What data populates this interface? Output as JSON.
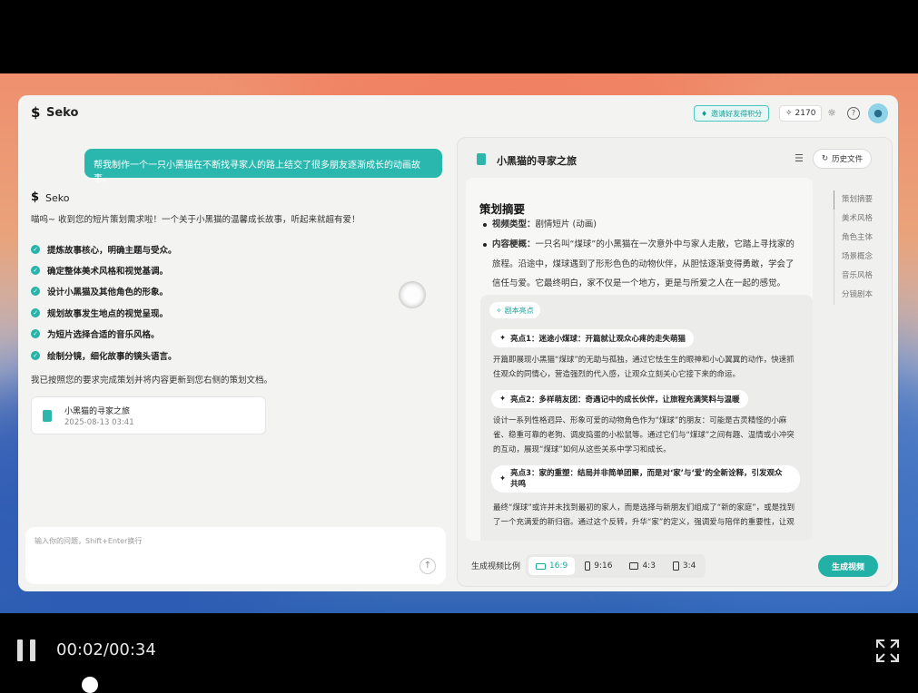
{
  "app": {
    "brand": "Seko",
    "invite_label": "邀请好友得积分",
    "credits": "2170",
    "icons": [
      "sun-icon",
      "help-icon",
      "user-avatar-icon"
    ]
  },
  "chat": {
    "user_message": "帮我制作一个一只小黑猫在不断找寻家人的路上结交了很多朋友逐渐成长的动画故事。",
    "assistant_name": "Seko",
    "intro": "喵呜~ 收到您的短片策划需求啦！一个关于小黑猫的温馨成长故事，听起来就超有爱！",
    "tasks": [
      "提炼故事核心，明确主题与受众。",
      "确定整体美术风格和视觉基调。",
      "设计小黑猫及其他角色的形象。",
      "规划故事发生地点的视觉呈现。",
      "为短片选择合适的音乐风格。",
      "绘制分镜，细化故事的镜头语言。"
    ],
    "completion": "我已按照您的要求完成策划并将内容更新到您右侧的策划文档。",
    "doc_card": {
      "title": "小黑猫的寻家之旅",
      "date": "2025-08-13 03:41"
    },
    "input_placeholder": "输入你的问题，Shift+Enter换行"
  },
  "doc": {
    "title": "小黑猫的寻家之旅",
    "history_label": "历史文件",
    "summary_title": "策划摘要",
    "video_type_label": "视频类型：",
    "video_type": "剧情短片 (动画)",
    "synopsis_label": "内容梗概：",
    "synopsis_lines": [
      "一只名叫“煤球”的小黑猫在一次意外中与家人走散，它踏上寻找家的",
      "旅程。沿途中，煤球遇到了形形色色的动物伙伴，从胆怯逐渐变得勇敢，学会了",
      "信任与爱。它最终明白，家不仅是一个地方，更是与所爱之人在一起的感觉。"
    ],
    "highlights_tag": "剧本亮点",
    "highlights": [
      {
        "title": "亮点1：迷途小煤球：开篇就让观众心疼的走失萌猫",
        "lines": [
          "开篇即展现小黑猫“煤球”的无助与孤独，通过它怯生生的眼神和小心翼翼的动作，快速抓",
          "住观众的同情心，营造强烈的代入感，让观众立刻关心它接下来的命运。"
        ]
      },
      {
        "title": "亮点2：多样萌友团：奇遇记中的成长伙伴，让旅程充满笑料与温暖",
        "lines": [
          "设计一系列性格迥异、形象可爱的动物角色作为“煤球”的朋友：可能是古灵精怪的小麻",
          "雀、稳重可靠的老狗、调皮捣蛋的小松鼠等。通过它们与“煤球”之间有趣、温情或小冲突",
          "的互动，展现“煤球”如何从这些关系中学习和成长。"
        ]
      },
      {
        "title_l1": "亮点3：家的重塑：结局并非简单团聚，而是对‘家’与‘爱’的全新诠释，引发观众",
        "title_l2": "共鸣",
        "lines": [
          "最终“煤球”或许并未找到最初的家人，而是选择与新朋友们组成了“新的家庭”，或是找到",
          "了一个充满爱的新归宿。通过这个反转，升华“家”的定义，强调爱与陪伴的重要性，让观"
        ]
      }
    ],
    "nav": [
      "策划摘要",
      "美术风格",
      "角色主体",
      "场景概念",
      "音乐风格",
      "分镜剧本"
    ],
    "ratio_label": "生成视频比例",
    "ratios": [
      "16:9",
      "9:16",
      "4:3",
      "3:4"
    ],
    "active_ratio": "16:9",
    "generate_label": "生成视频"
  },
  "player": {
    "time": "00:02/00:34",
    "progress": 0.059
  },
  "colors": {
    "accent": "#22b0a7",
    "bubble": "#29b7ae"
  }
}
